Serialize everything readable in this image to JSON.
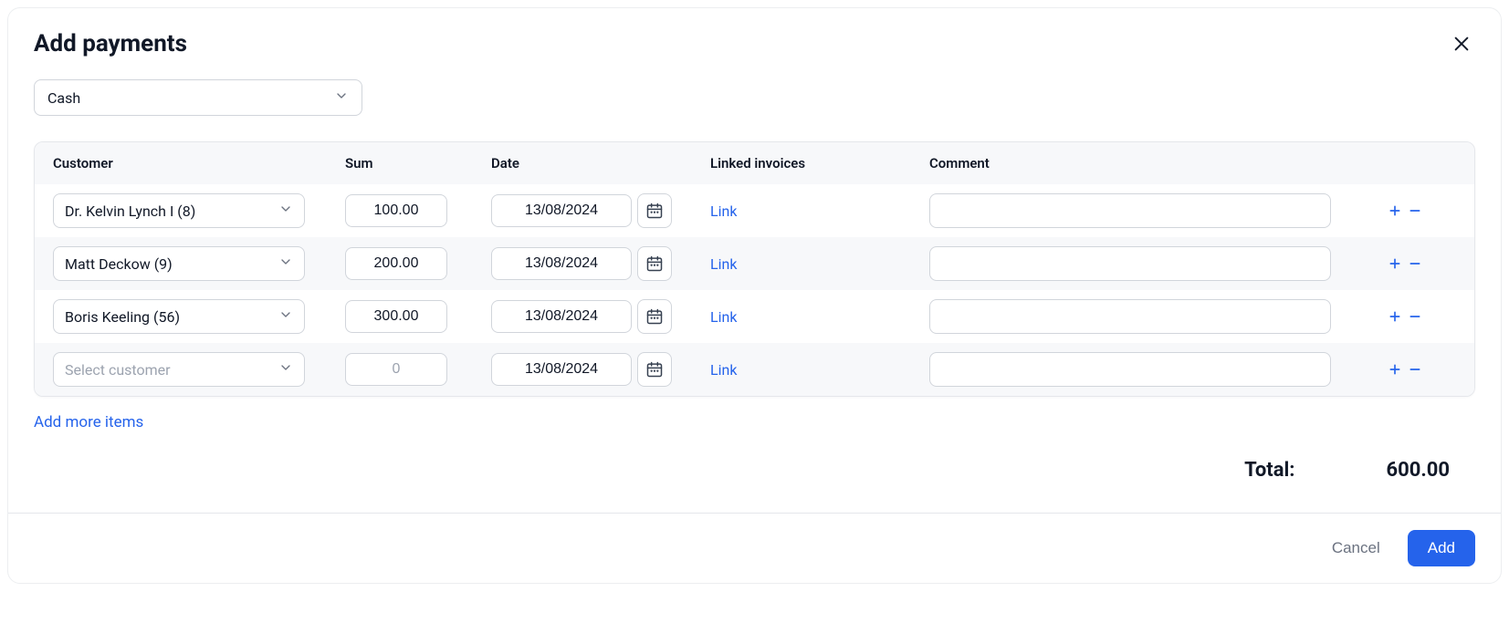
{
  "modal": {
    "title": "Add payments",
    "payment_method": "Cash",
    "customer_placeholder": "Select customer",
    "sum_placeholder": "0",
    "add_more_label": "Add more items",
    "total_label": "Total:",
    "total_value": "600.00",
    "cancel_label": "Cancel",
    "add_label": "Add"
  },
  "headers": {
    "customer": "Customer",
    "sum": "Sum",
    "date": "Date",
    "linked": "Linked invoices",
    "comment": "Comment"
  },
  "rows": [
    {
      "customer": "Dr. Kelvin Lynch I (8)",
      "sum": "100.00",
      "date": "13/08/2024",
      "link_label": "Link",
      "comment": ""
    },
    {
      "customer": "Matt Deckow (9)",
      "sum": "200.00",
      "date": "13/08/2024",
      "link_label": "Link",
      "comment": ""
    },
    {
      "customer": "Boris Keeling (56)",
      "sum": "300.00",
      "date": "13/08/2024",
      "link_label": "Link",
      "comment": ""
    },
    {
      "customer": "",
      "sum": "",
      "date": "13/08/2024",
      "link_label": "Link",
      "comment": ""
    }
  ]
}
